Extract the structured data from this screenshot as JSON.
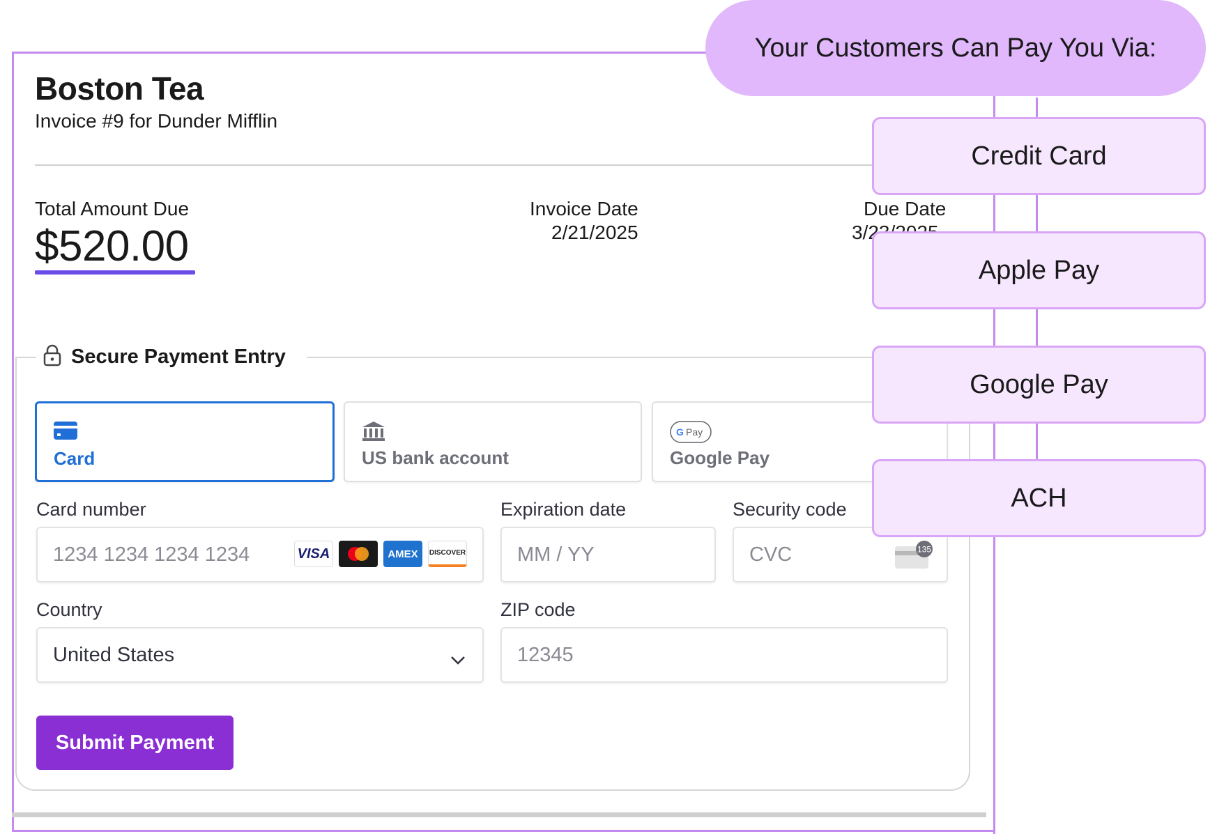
{
  "invoice": {
    "store_name": "Boston Tea",
    "subtitle": "Invoice #9 for Dunder Mifflin",
    "total_label": "Total Amount Due",
    "total_value": "$520.00",
    "invoice_date_label": "Invoice Date",
    "invoice_date_value": "2/21/2025",
    "due_date_label": "Due Date",
    "due_date_value": "3/23/2025"
  },
  "payment": {
    "section_title": "Secure Payment Entry",
    "methods": [
      {
        "label": "Card",
        "icon": "card-icon",
        "active": true
      },
      {
        "label": "US bank account",
        "icon": "bank-icon",
        "active": false
      },
      {
        "label": "Google Pay",
        "icon": "google-pay-icon",
        "active": false
      }
    ],
    "card_number_label": "Card number",
    "card_number_placeholder": "1234 1234 1234 1234",
    "card_brands": [
      "VISA",
      "Mastercard",
      "AMEX",
      "DISCOVER"
    ],
    "expiration_label": "Expiration date",
    "expiration_placeholder": "MM / YY",
    "security_label": "Security code",
    "security_placeholder": "CVC",
    "cvc_badge": "135",
    "country_label": "Country",
    "country_value": "United States",
    "zip_label": "ZIP code",
    "zip_placeholder": "12345",
    "submit_label": "Submit Payment"
  },
  "callout": {
    "header": "Your Customers Can Pay You Via:",
    "options": [
      "Credit Card",
      "Apple Pay",
      "Google Pay",
      "ACH"
    ]
  },
  "colors": {
    "accent_purple": "#8a2fd3",
    "callout_purple": "#e0b8fb",
    "active_blue": "#1f6fd6",
    "amount_underline": "#6a4ce8"
  }
}
